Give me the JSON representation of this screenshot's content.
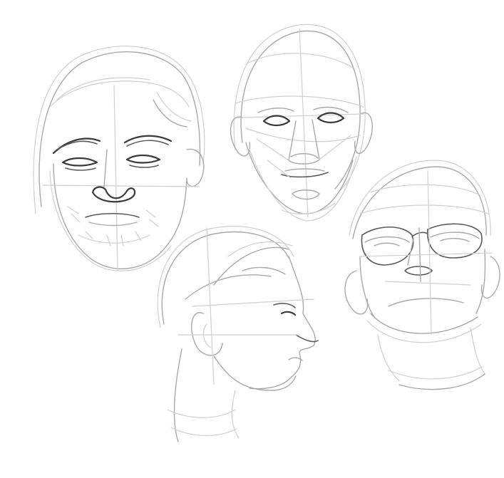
{
  "canvas": {
    "background": "#ffffff",
    "stroke_colors": {
      "light": "#cfcfcf",
      "medium": "#a9a9a9",
      "dark": "#3a3a3a"
    }
  },
  "sketches": [
    {
      "id": "bearded-man-front",
      "icon": "head-sketch-front-beard"
    },
    {
      "id": "bald-head-front",
      "icon": "head-sketch-front-bald"
    },
    {
      "id": "head-profile-right",
      "icon": "head-sketch-profile"
    },
    {
      "id": "man-glasses-upward",
      "icon": "head-sketch-upward-glasses"
    }
  ]
}
